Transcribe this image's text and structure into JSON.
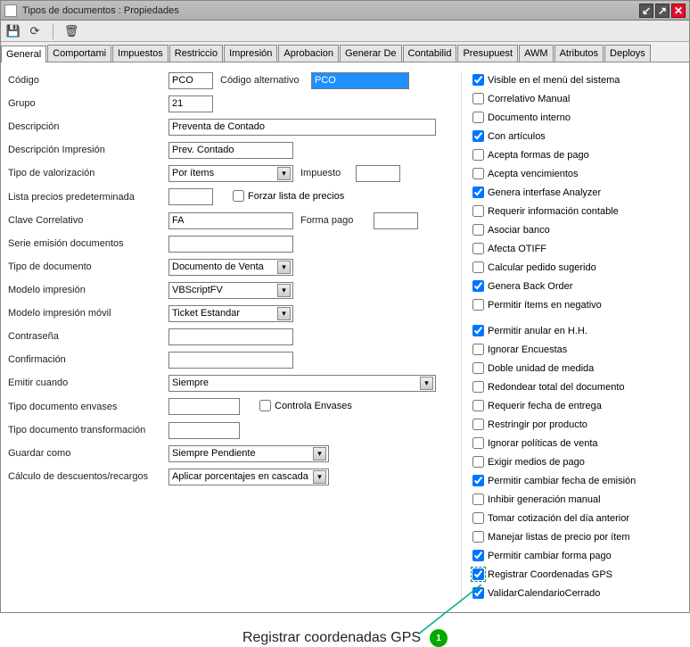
{
  "window": {
    "title": "Tipos de documentos : Propiedades",
    "min_icon": "↙",
    "max_icon": "↗",
    "close_icon": "✕"
  },
  "tabs": [
    "General",
    "Comportamiento",
    "Impuestos",
    "Restricciones",
    "Impresión",
    "Aprobaciones",
    "Generar Des",
    "Contabilidad",
    "Presupuesto",
    "AWM",
    "Atributos",
    "Deploys"
  ],
  "labels": {
    "codigo": "Código",
    "codigo_alt": "Código alternativo",
    "grupo": "Grupo",
    "descripcion": "Descripción",
    "descripcion_imp": "Descripción Impresión",
    "tipo_val": "Tipo de valorización",
    "impuesto": "Impuesto",
    "lista_pred": "Lista precios predeterminada",
    "forzar_lista": "Forzar lista de precios",
    "clave_corr": "Clave Correlativo",
    "forma_pago": "Forma pago",
    "serie_emision": "Serie emisión documentos",
    "tipo_doc": "Tipo de documento",
    "modelo_imp": "Modelo impresión",
    "modelo_imp_movil": "Modelo impresión móvil",
    "contrasena": "Contraseña",
    "confirmacion": "Confirmación",
    "emitir_cuando": "Emitir cuando",
    "tipo_doc_env": "Tipo documento envases",
    "controla_env": "Controla Envases",
    "tipo_doc_trans": "Tipo documento transformación",
    "guardar_como": "Guardar como",
    "calc_desc": "Cálculo de descuentos/recargos"
  },
  "values": {
    "codigo": "PCO",
    "codigo_alt": "PCO",
    "grupo": "21",
    "descripcion": "Preventa de Contado",
    "descripcion_imp": "Prev. Contado",
    "tipo_val": "Por ítems",
    "impuesto": "",
    "lista_pred": "",
    "clave_corr": "FA",
    "forma_pago": "",
    "serie_emision": "",
    "tipo_doc": "Documento de Venta",
    "modelo_imp": "VBScriptFV",
    "modelo_imp_movil": "Ticket Estandar",
    "contrasena": "",
    "confirmacion": "",
    "emitir_cuando": "Siempre",
    "tipo_doc_env": "",
    "tipo_doc_trans": "",
    "guardar_como": "Siempre Pendiente",
    "calc_desc": "Aplicar porcentajes en cascada"
  },
  "checks": [
    {
      "label": "Visible en el menú del sistema",
      "checked": true
    },
    {
      "label": "Correlativo Manual",
      "checked": false
    },
    {
      "label": "Documento interno",
      "checked": false
    },
    {
      "label": "Con artículos",
      "checked": true
    },
    {
      "label": "Acepta formas de pago",
      "checked": false
    },
    {
      "label": "Acepta vencimientos",
      "checked": false
    },
    {
      "label": "Genera interfase Analyzer",
      "checked": true
    },
    {
      "label": "Requerir información contable",
      "checked": false
    },
    {
      "label": "Asociar banco",
      "checked": false
    },
    {
      "label": "Afecta OTIFF",
      "checked": false
    },
    {
      "label": "Calcular pedido sugerido",
      "checked": false
    },
    {
      "label": "Genera Back Order",
      "checked": true
    },
    {
      "label": "Permitir ítems en negativo",
      "checked": false
    },
    {
      "label": " ",
      "checked": false,
      "spacer": true
    },
    {
      "label": "Permitir anular en H.H.",
      "checked": true
    },
    {
      "label": "Ignorar Encuestas",
      "checked": false
    },
    {
      "label": "Doble unidad de medida",
      "checked": false
    },
    {
      "label": "Redondear total del documento",
      "checked": false
    },
    {
      "label": "Requerir fecha de entrega",
      "checked": false
    },
    {
      "label": "Restringir por producto",
      "checked": false
    },
    {
      "label": "Ignorar políticas de venta",
      "checked": false
    },
    {
      "label": "Exigir medios de pago",
      "checked": false
    },
    {
      "label": "Permitir cambiar fecha de emisión",
      "checked": true
    },
    {
      "label": "Inhibir generación manual",
      "checked": false
    },
    {
      "label": "Tomar cotización del día anterior",
      "checked": false
    },
    {
      "label": "Manejar listas de precio por ítem",
      "checked": false
    },
    {
      "label": "Permitir cambiar forma pago",
      "checked": true
    },
    {
      "label": "Registrar Coordenadas GPS",
      "checked": true,
      "highlight": true
    },
    {
      "label": "ValidarCalendarioCerrado",
      "checked": true
    }
  ],
  "callout": {
    "text": "Registrar coordenadas GPS",
    "badge": "1"
  }
}
